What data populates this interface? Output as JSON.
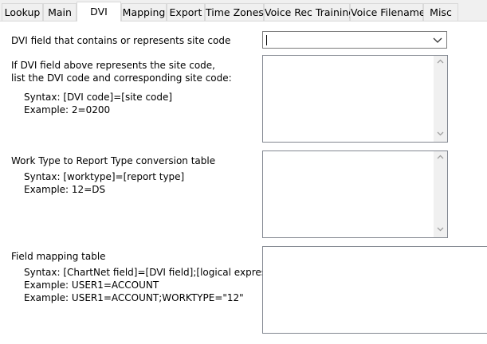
{
  "tabs": [
    {
      "label": "Lookup",
      "active": false
    },
    {
      "label": "Main",
      "active": false
    },
    {
      "label": "DVI",
      "active": true
    },
    {
      "label": "Mapping",
      "active": false
    },
    {
      "label": "Export",
      "active": false
    },
    {
      "label": "Time Zones",
      "active": false
    },
    {
      "label": "Voice Rec Training",
      "active": false
    },
    {
      "label": "Voice Filename",
      "active": false
    },
    {
      "label": "Misc",
      "active": false
    }
  ],
  "site_code": {
    "label": "DVI field that contains or represents site code",
    "value": ""
  },
  "site_mapping": {
    "line1": "If DVI field above represents the site code,",
    "line2": "list the DVI code and corresponding site code:",
    "syntax": "Syntax:  [DVI code]=[site code]",
    "example": "Example:  2=0200",
    "value": ""
  },
  "work_type": {
    "label": "Work Type to Report Type conversion table",
    "syntax": "Syntax:  [worktype]=[report type]",
    "example": "Example:  12=DS",
    "value": ""
  },
  "field_mapping": {
    "label": "Field mapping table",
    "syntax": "Syntax:  [ChartNet field]=[DVI field];[logical expression]",
    "example1": "Example:  USER1=ACCOUNT",
    "example2": "Example:  USER1=ACCOUNT;WORKTYPE=\"12\"",
    "value": ""
  },
  "colors": {
    "tab_bg": "#f0f0f0",
    "border": "#828790",
    "scroll_arrow": "#a0a0a0"
  }
}
